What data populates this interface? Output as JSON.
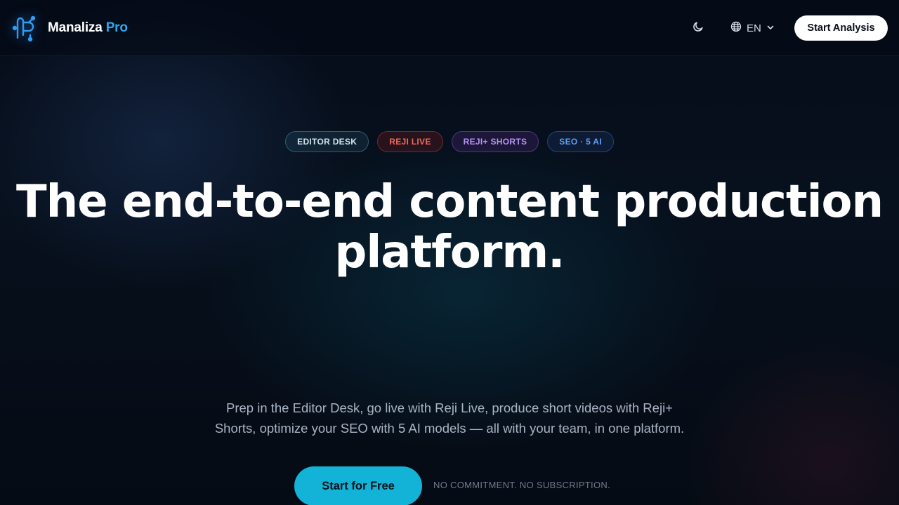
{
  "header": {
    "logo": {
      "icon": "brain-circuit-icon",
      "brand_primary": "Manaliza",
      "brand_accent": "Pro",
      "accent_color": "#2fa8f0"
    },
    "theme_toggle": {
      "icon": "moon-icon"
    },
    "language": {
      "icon": "globe-icon",
      "value": "EN",
      "chevron": "chevron-down-icon"
    },
    "cta_label": "Start Analysis"
  },
  "hero": {
    "badges": [
      {
        "label": "EDITOR DESK",
        "color": "#cfe3ee"
      },
      {
        "label": "REJI LIVE",
        "color": "#f06a5a"
      },
      {
        "label": "REJI+ SHORTS",
        "color": "#b994f5"
      },
      {
        "label": "SEO · 5 AI",
        "color": "#5f9ff0"
      }
    ],
    "title_line1": "The end-to-end content production",
    "title_line2": "platform.",
    "subtitle_line1": "Prep in the Editor Desk, go live with Reji Live, produce short videos with Reji+",
    "subtitle_line2": "Shorts, optimize your SEO with 5 AI models — all with your team, in one platform.",
    "cta_label": "Start for Free",
    "cta_color": "#12b3d6",
    "note": "NO COMMITMENT. NO SUBSCRIPTION."
  }
}
